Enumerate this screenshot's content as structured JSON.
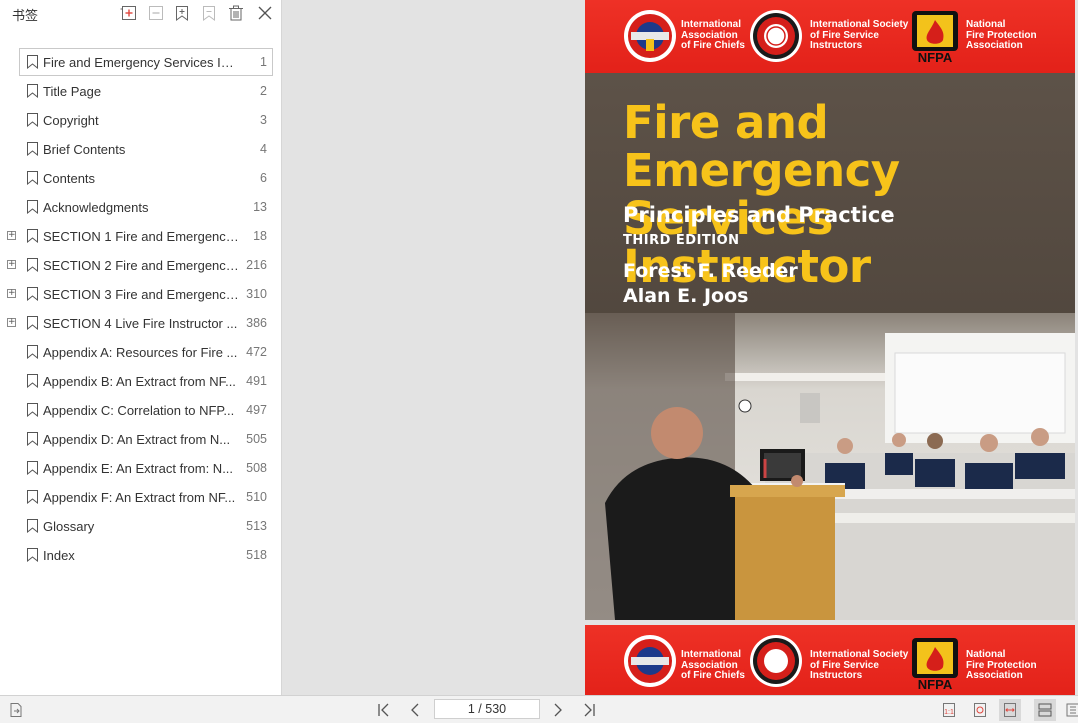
{
  "sidebar": {
    "title": "书签",
    "toolbar": [
      "add-bookmark-icon",
      "remove-child-icon",
      "expand-bookmark-icon",
      "bookmark-icon",
      "delete-icon",
      "close-icon"
    ],
    "bookmarks": [
      {
        "label": "Fire and Emergency Services Instr...",
        "page": "1",
        "expandable": false,
        "selected": true
      },
      {
        "label": "Title Page",
        "page": "2",
        "expandable": false
      },
      {
        "label": "Copyright",
        "page": "3",
        "expandable": false
      },
      {
        "label": "Brief Contents",
        "page": "4",
        "expandable": false
      },
      {
        "label": "Contents",
        "page": "6",
        "expandable": false
      },
      {
        "label": "Acknowledgments",
        "page": "13",
        "expandable": false
      },
      {
        "label": "SECTION 1 Fire and Emergency ...",
        "page": "18",
        "expandable": true
      },
      {
        "label": "SECTION 2 Fire and Emergency...",
        "page": "216",
        "expandable": true
      },
      {
        "label": "SECTION 3 Fire and Emergency...",
        "page": "310",
        "expandable": true
      },
      {
        "label": "SECTION 4 Live Fire Instructor ...",
        "page": "386",
        "expandable": true
      },
      {
        "label": "Appendix A: Resources for Fire ...",
        "page": "472",
        "expandable": false
      },
      {
        "label": "Appendix B: An Extract from NF...",
        "page": "491",
        "expandable": false
      },
      {
        "label": "Appendix C: Correlation to NFP...",
        "page": "497",
        "expandable": false
      },
      {
        "label": "Appendix D: An Extract from N...",
        "page": "505",
        "expandable": false
      },
      {
        "label": "Appendix E: An Extract from: N...",
        "page": "508",
        "expandable": false
      },
      {
        "label": "Appendix F: An Extract from NF...",
        "page": "510",
        "expandable": false
      },
      {
        "label": "Glossary",
        "page": "513",
        "expandable": false
      },
      {
        "label": "Index",
        "page": "518",
        "expandable": false
      }
    ]
  },
  "cover": {
    "orgs": [
      {
        "name": "International\nAssociation\nof Fire Chiefs"
      },
      {
        "name": "International Society\nof Fire Service\nInstructors"
      },
      {
        "name": "National\nFire Protection\nAssociation"
      }
    ],
    "nfpa_logo": "NFPA",
    "title_line1": "Fire and Emergency",
    "title_line2": "Services Instructor",
    "subtitle": "Principles and Practice",
    "edition": "THIRD EDITION",
    "author1": "Forest F. Reeder",
    "author2": "Alan E. Joos"
  },
  "nav": {
    "page_indicator": "1 / 530",
    "icons": [
      "first-page-icon",
      "prev-page-icon",
      "next-page-icon",
      "last-page-icon"
    ]
  },
  "view_modes": [
    "single-page-icon",
    "rotate-icon",
    "fit-width-icon",
    "continuous-icon",
    "two-page-icon"
  ],
  "colors": {
    "accent_red": "#e52821",
    "title_yellow": "#f7c31a"
  }
}
